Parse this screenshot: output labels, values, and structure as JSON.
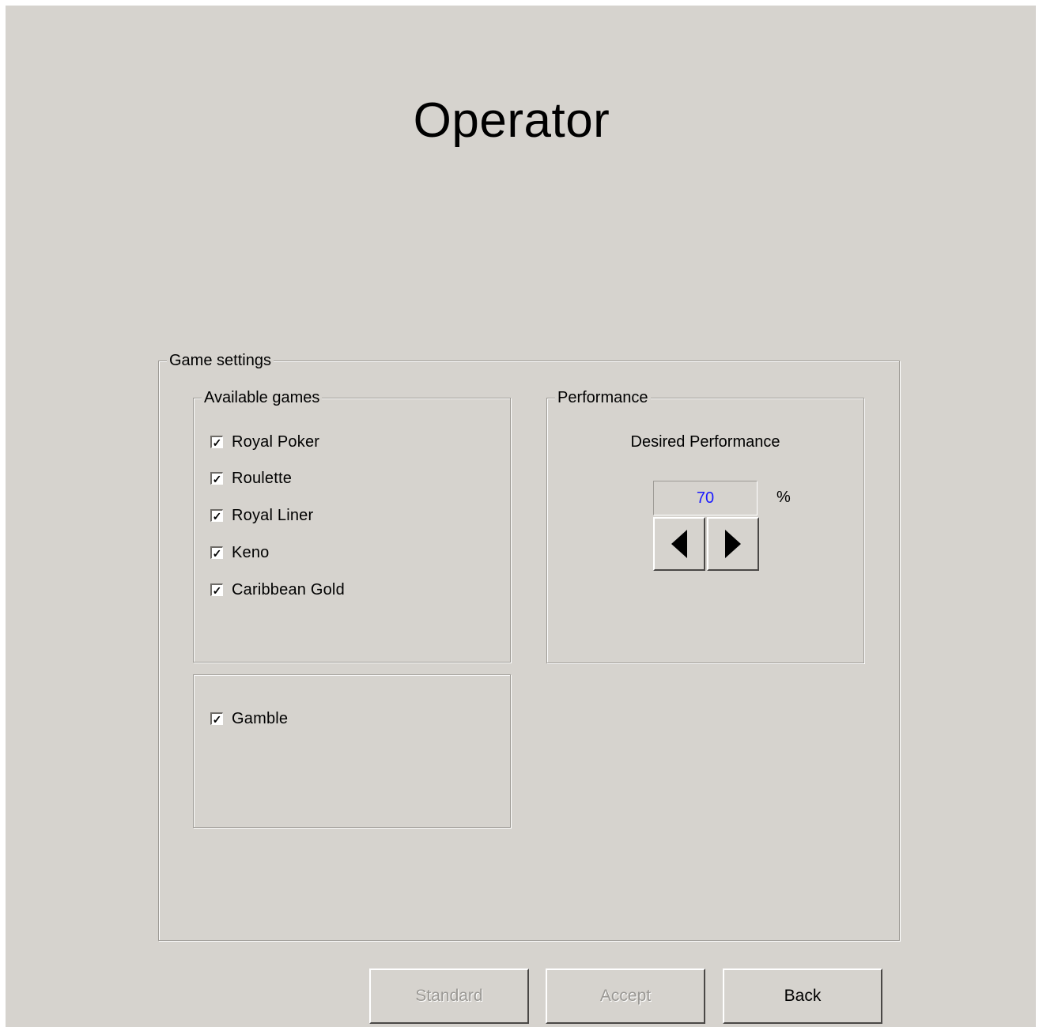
{
  "window": {
    "title": "Operator"
  },
  "game_settings": {
    "legend": "Game settings",
    "available_games": {
      "legend": "Available games",
      "items": [
        {
          "label": "Royal Poker",
          "checked": true
        },
        {
          "label": "Roulette",
          "checked": true
        },
        {
          "label": "Royal Liner",
          "checked": true
        },
        {
          "label": "Keno",
          "checked": true
        },
        {
          "label": "Caribbean Gold",
          "checked": true
        }
      ]
    },
    "gamble": {
      "label": "Gamble",
      "checked": true
    },
    "performance": {
      "legend": "Performance",
      "label": "Desired Performance",
      "value": "70",
      "unit": "%",
      "value_color": "#1a1aff",
      "decrease_icon": "triangle-left-icon",
      "increase_icon": "triangle-right-icon"
    }
  },
  "buttons": {
    "standard": {
      "label": "Standard",
      "enabled": false
    },
    "accept": {
      "label": "Accept",
      "enabled": false
    },
    "back": {
      "label": "Back",
      "enabled": true
    }
  },
  "colors": {
    "background": "#d6d3ce",
    "disabled_text": "#9a9894"
  }
}
